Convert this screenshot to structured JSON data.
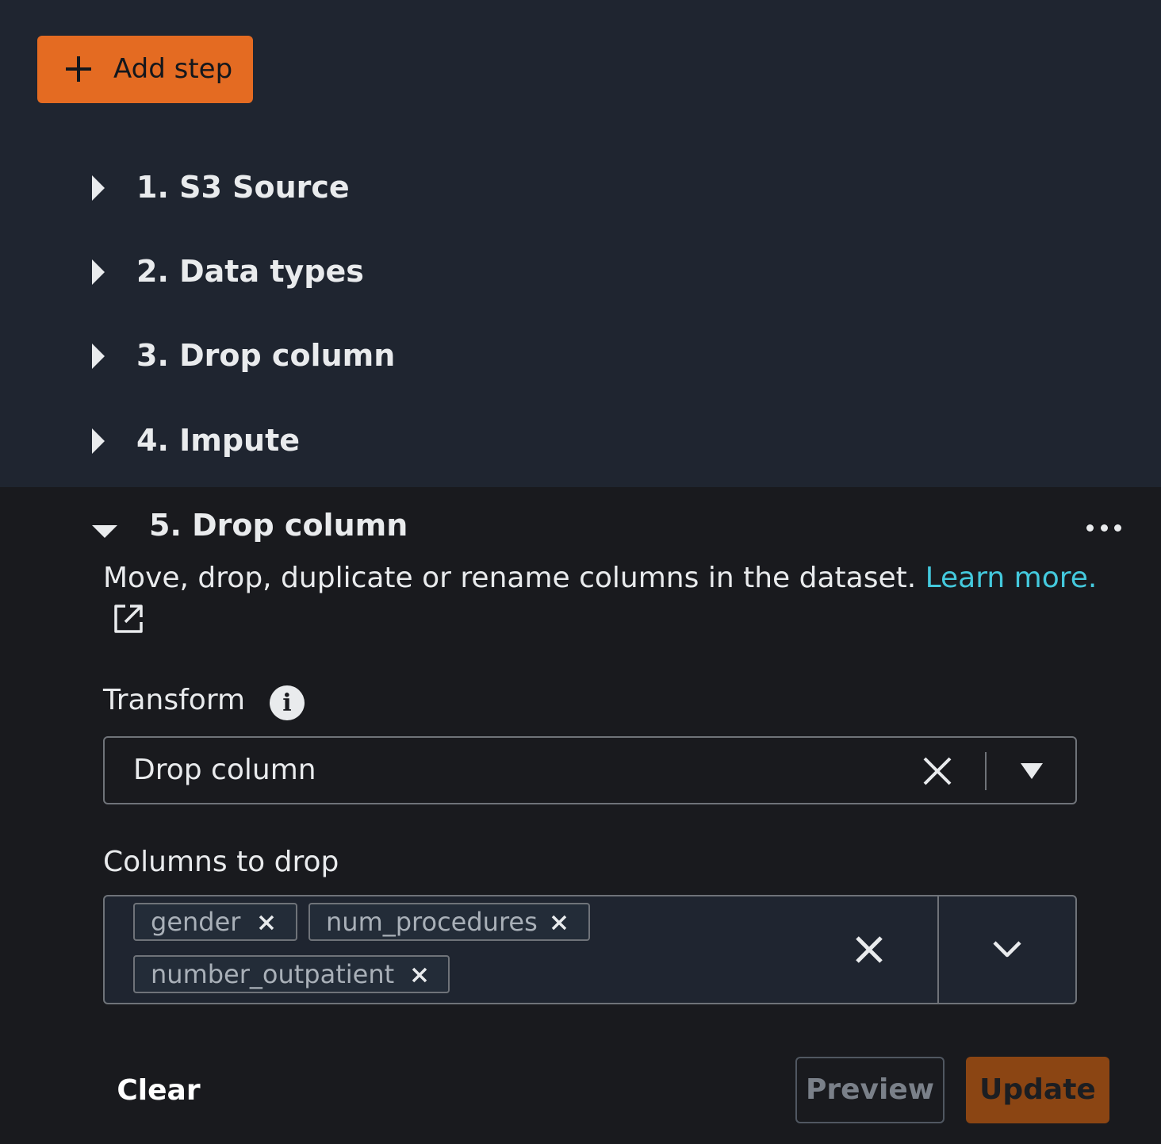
{
  "toolbar": {
    "add_step_label": "Add step"
  },
  "steps": [
    {
      "label": "1. S3 Source"
    },
    {
      "label": "2. Data types"
    },
    {
      "label": "3. Drop column"
    },
    {
      "label": "4. Impute"
    }
  ],
  "expanded_step": {
    "title": "5. Drop column",
    "description": "Move, drop, duplicate or rename columns in the dataset.",
    "learn_more": "Learn more.",
    "transform_label": "Transform",
    "transform_value": "Drop column",
    "columns_label": "Columns to drop",
    "columns": [
      "gender",
      "num_procedures",
      "number_outpatient"
    ]
  },
  "actions": {
    "clear": "Clear",
    "preview": "Preview",
    "update": "Update"
  },
  "colors": {
    "accent": "#e46b22",
    "link": "#44c9dd",
    "panel_top": "#1f2530",
    "panel_bottom": "#191a1e"
  }
}
